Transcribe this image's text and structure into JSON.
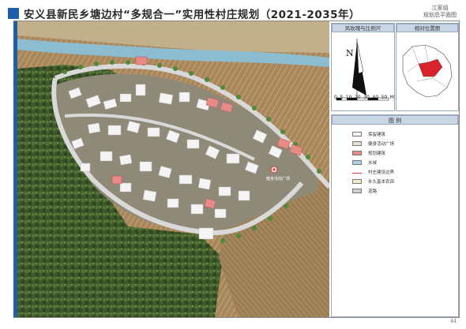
{
  "title": "安义县新民乡塘边村“多规合一”实用性村庄规划（2021-2035年）",
  "sheet": {
    "line1": "江家组",
    "line2": "规划总平面图"
  },
  "north_arrow": {
    "letter": "N"
  },
  "scale_panel": {
    "title": "风玫瑰与比例尺",
    "tick_labels": [
      "0",
      "5",
      "10",
      "20",
      "30",
      "40",
      "50"
    ],
    "unit": "M"
  },
  "location_panel": {
    "title": "相对位置图"
  },
  "legend": {
    "title": "图 例",
    "items": [
      {
        "label": "保留建筑",
        "color": "#f4f4f4"
      },
      {
        "label": "健身活动广场",
        "color": "#e7e2d2"
      },
      {
        "label": "规划建筑",
        "color": "#e88a86"
      },
      {
        "label": "水域",
        "color": "#a9d3e6"
      },
      {
        "label": "村庄建设边界",
        "color": "#d23a3a"
      },
      {
        "label": "永久基本农田",
        "color": "#f2efc0"
      },
      {
        "label": "道路",
        "color": "#cfcfcf"
      }
    ]
  },
  "map_labels": {
    "plaza": "健身活动广场"
  },
  "page_number": "44"
}
